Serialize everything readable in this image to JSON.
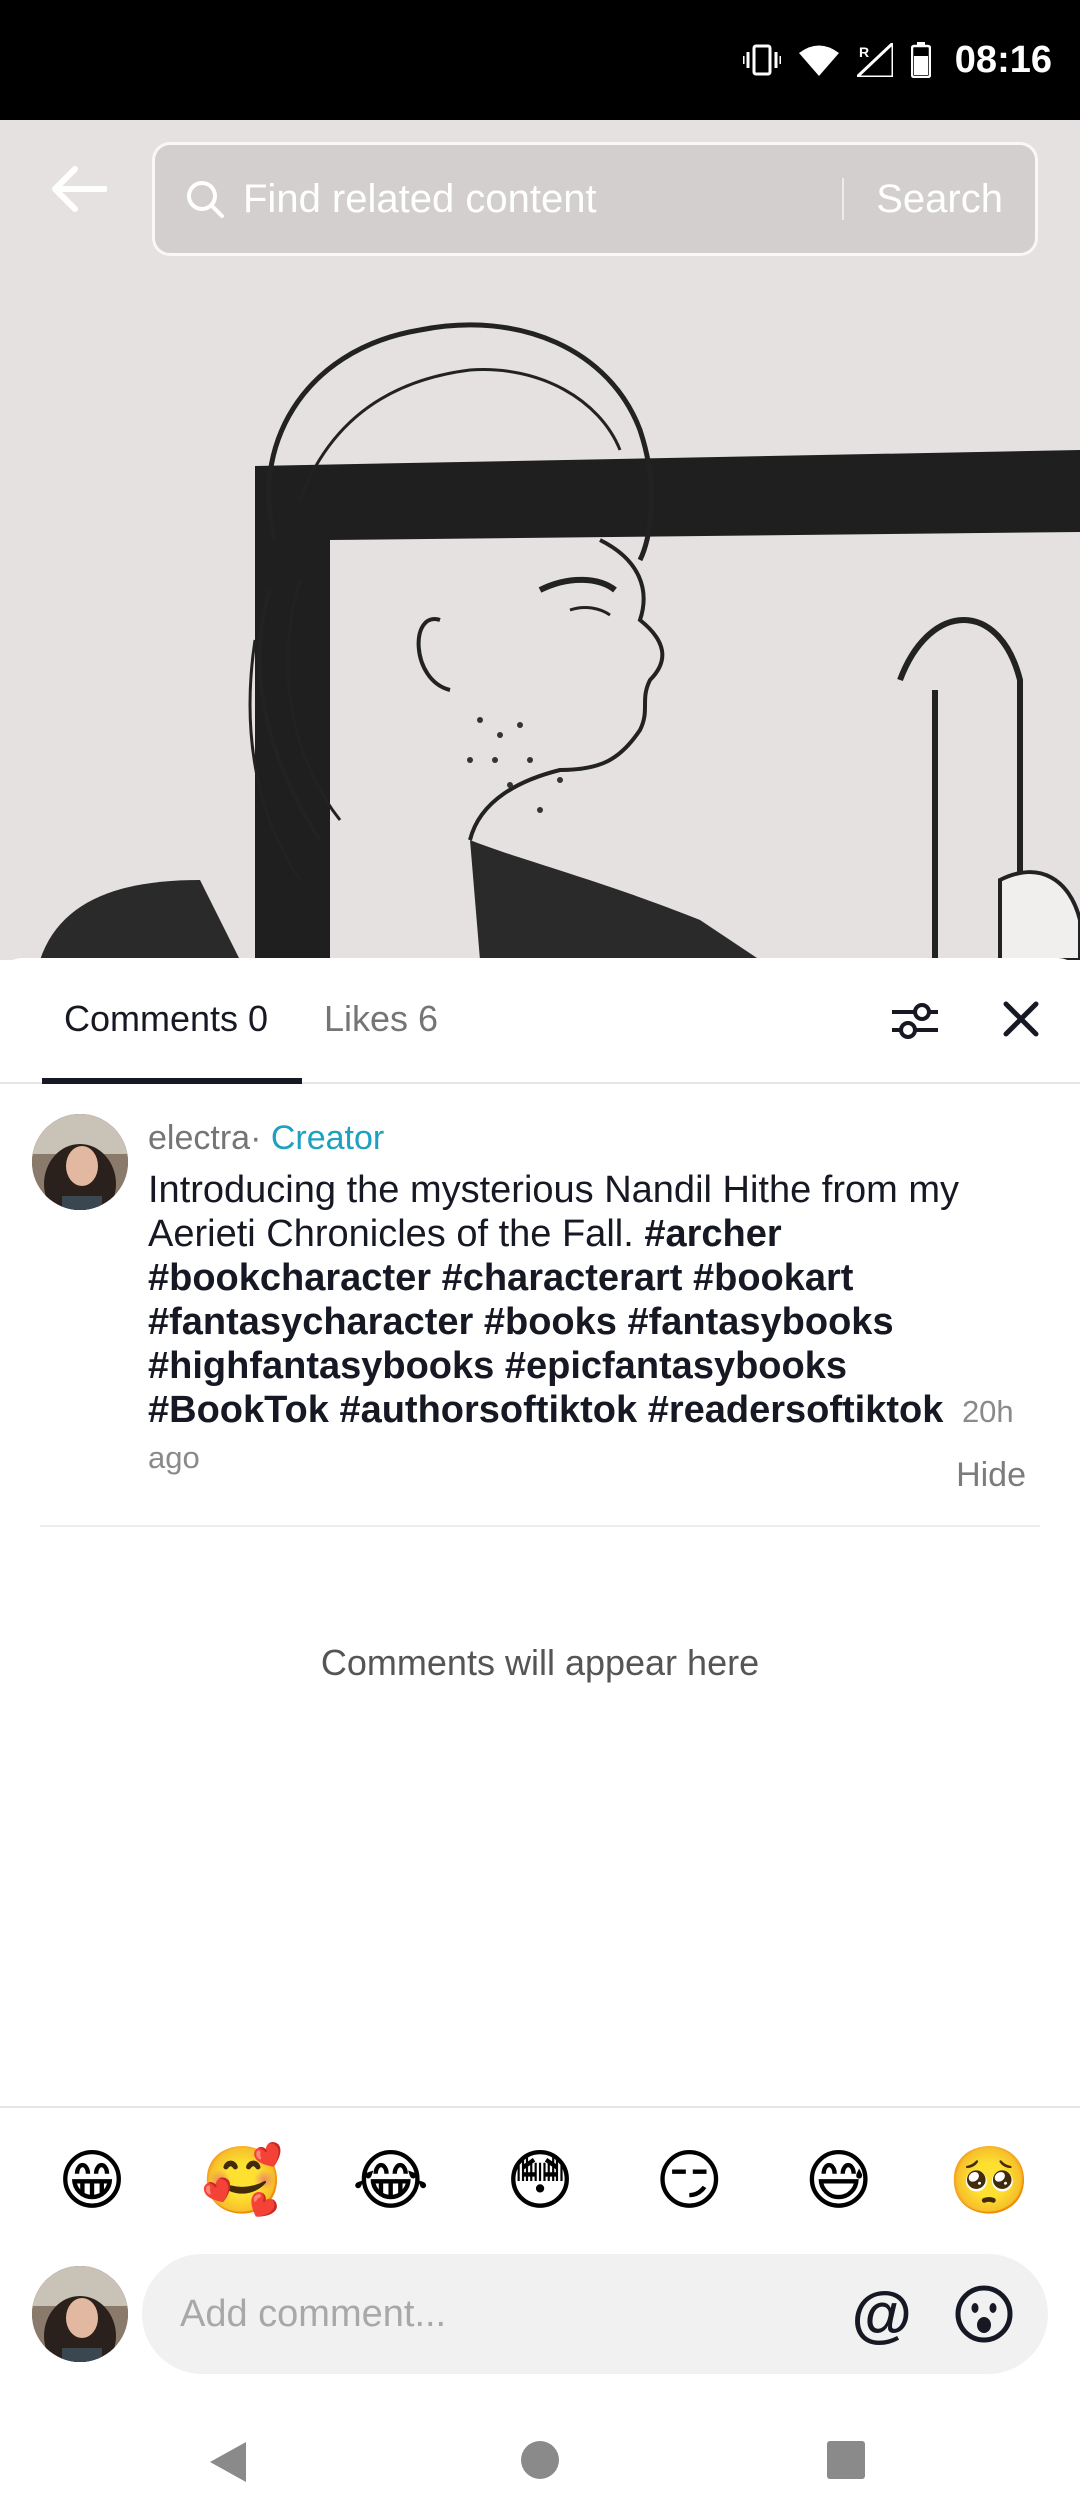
{
  "status_bar": {
    "time": "08:16",
    "icons": [
      "vibrate-icon",
      "wifi-icon",
      "signal-icon",
      "battery-icon"
    ]
  },
  "search": {
    "placeholder": "Find related content",
    "button_label": "Search"
  },
  "tabs": {
    "comments_label": "Comments 0",
    "likes_label": "Likes 6"
  },
  "comment": {
    "author": "electra",
    "separator": "·",
    "badge": "Creator",
    "text": "Introducing the mysterious Nandil Hithe from my Aerieti Chronicles of the Fall.",
    "hashtags": [
      "#archer",
      "#bookcharacter",
      "#characterart",
      "#bookart",
      "#fantasycharacter",
      "#books",
      "#fantasybooks",
      "#highfantasybooks",
      "#epicfantasybooks",
      "#BookTok",
      "#authorsoftiktok",
      "#readersoftiktok"
    ],
    "time_ago": "20h ago",
    "hide_label": "Hide"
  },
  "empty_message": "Comments will appear here",
  "emoji_bar": [
    "😁",
    "🥰",
    "😂",
    "😳",
    "😏",
    "😅",
    "🥺"
  ],
  "input": {
    "placeholder": "Add comment...",
    "mention_symbol": "@"
  },
  "colors": {
    "accent_creator": "#1ea0c0",
    "text_primary": "#161823",
    "text_secondary": "#757575"
  }
}
